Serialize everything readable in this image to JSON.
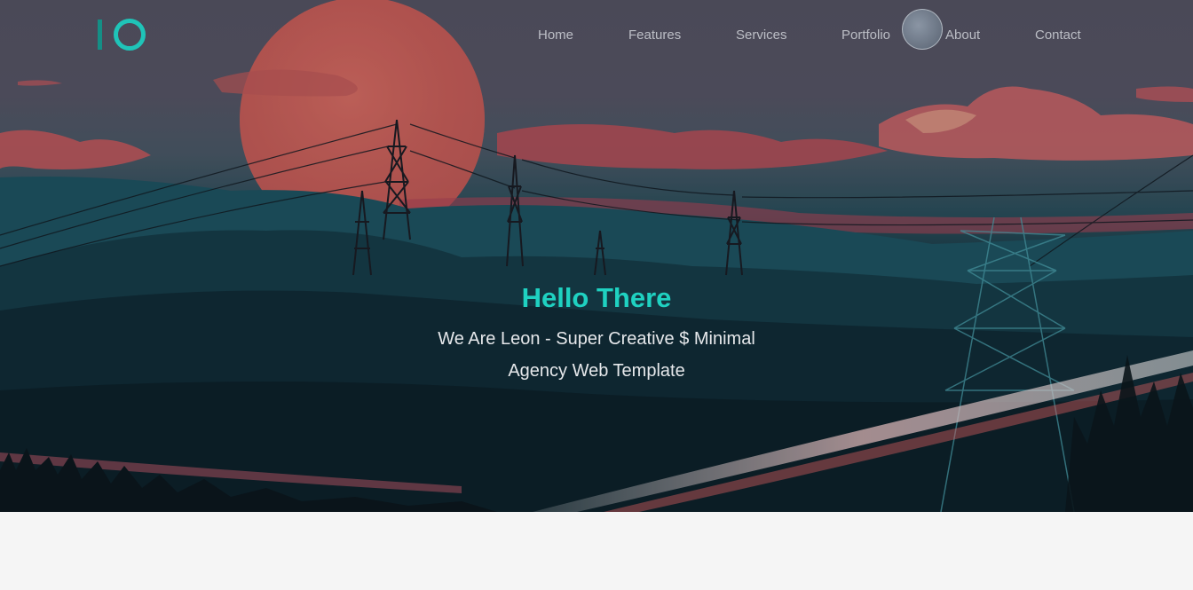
{
  "brand": {
    "logo_alt": "IO",
    "accent": "#1fd1c1",
    "logo_dark": "#148f86"
  },
  "nav": {
    "items": [
      {
        "label": "Home"
      },
      {
        "label": "Features"
      },
      {
        "label": "Services"
      },
      {
        "label": "Portfolio"
      },
      {
        "label": "About"
      },
      {
        "label": "Contact"
      }
    ]
  },
  "hero": {
    "title": "Hello There",
    "subtitle": "We Are Leon - Super Creative $ Minimal Agency Web Template",
    "background": "illustrated sunset landscape with power lines and highway"
  }
}
